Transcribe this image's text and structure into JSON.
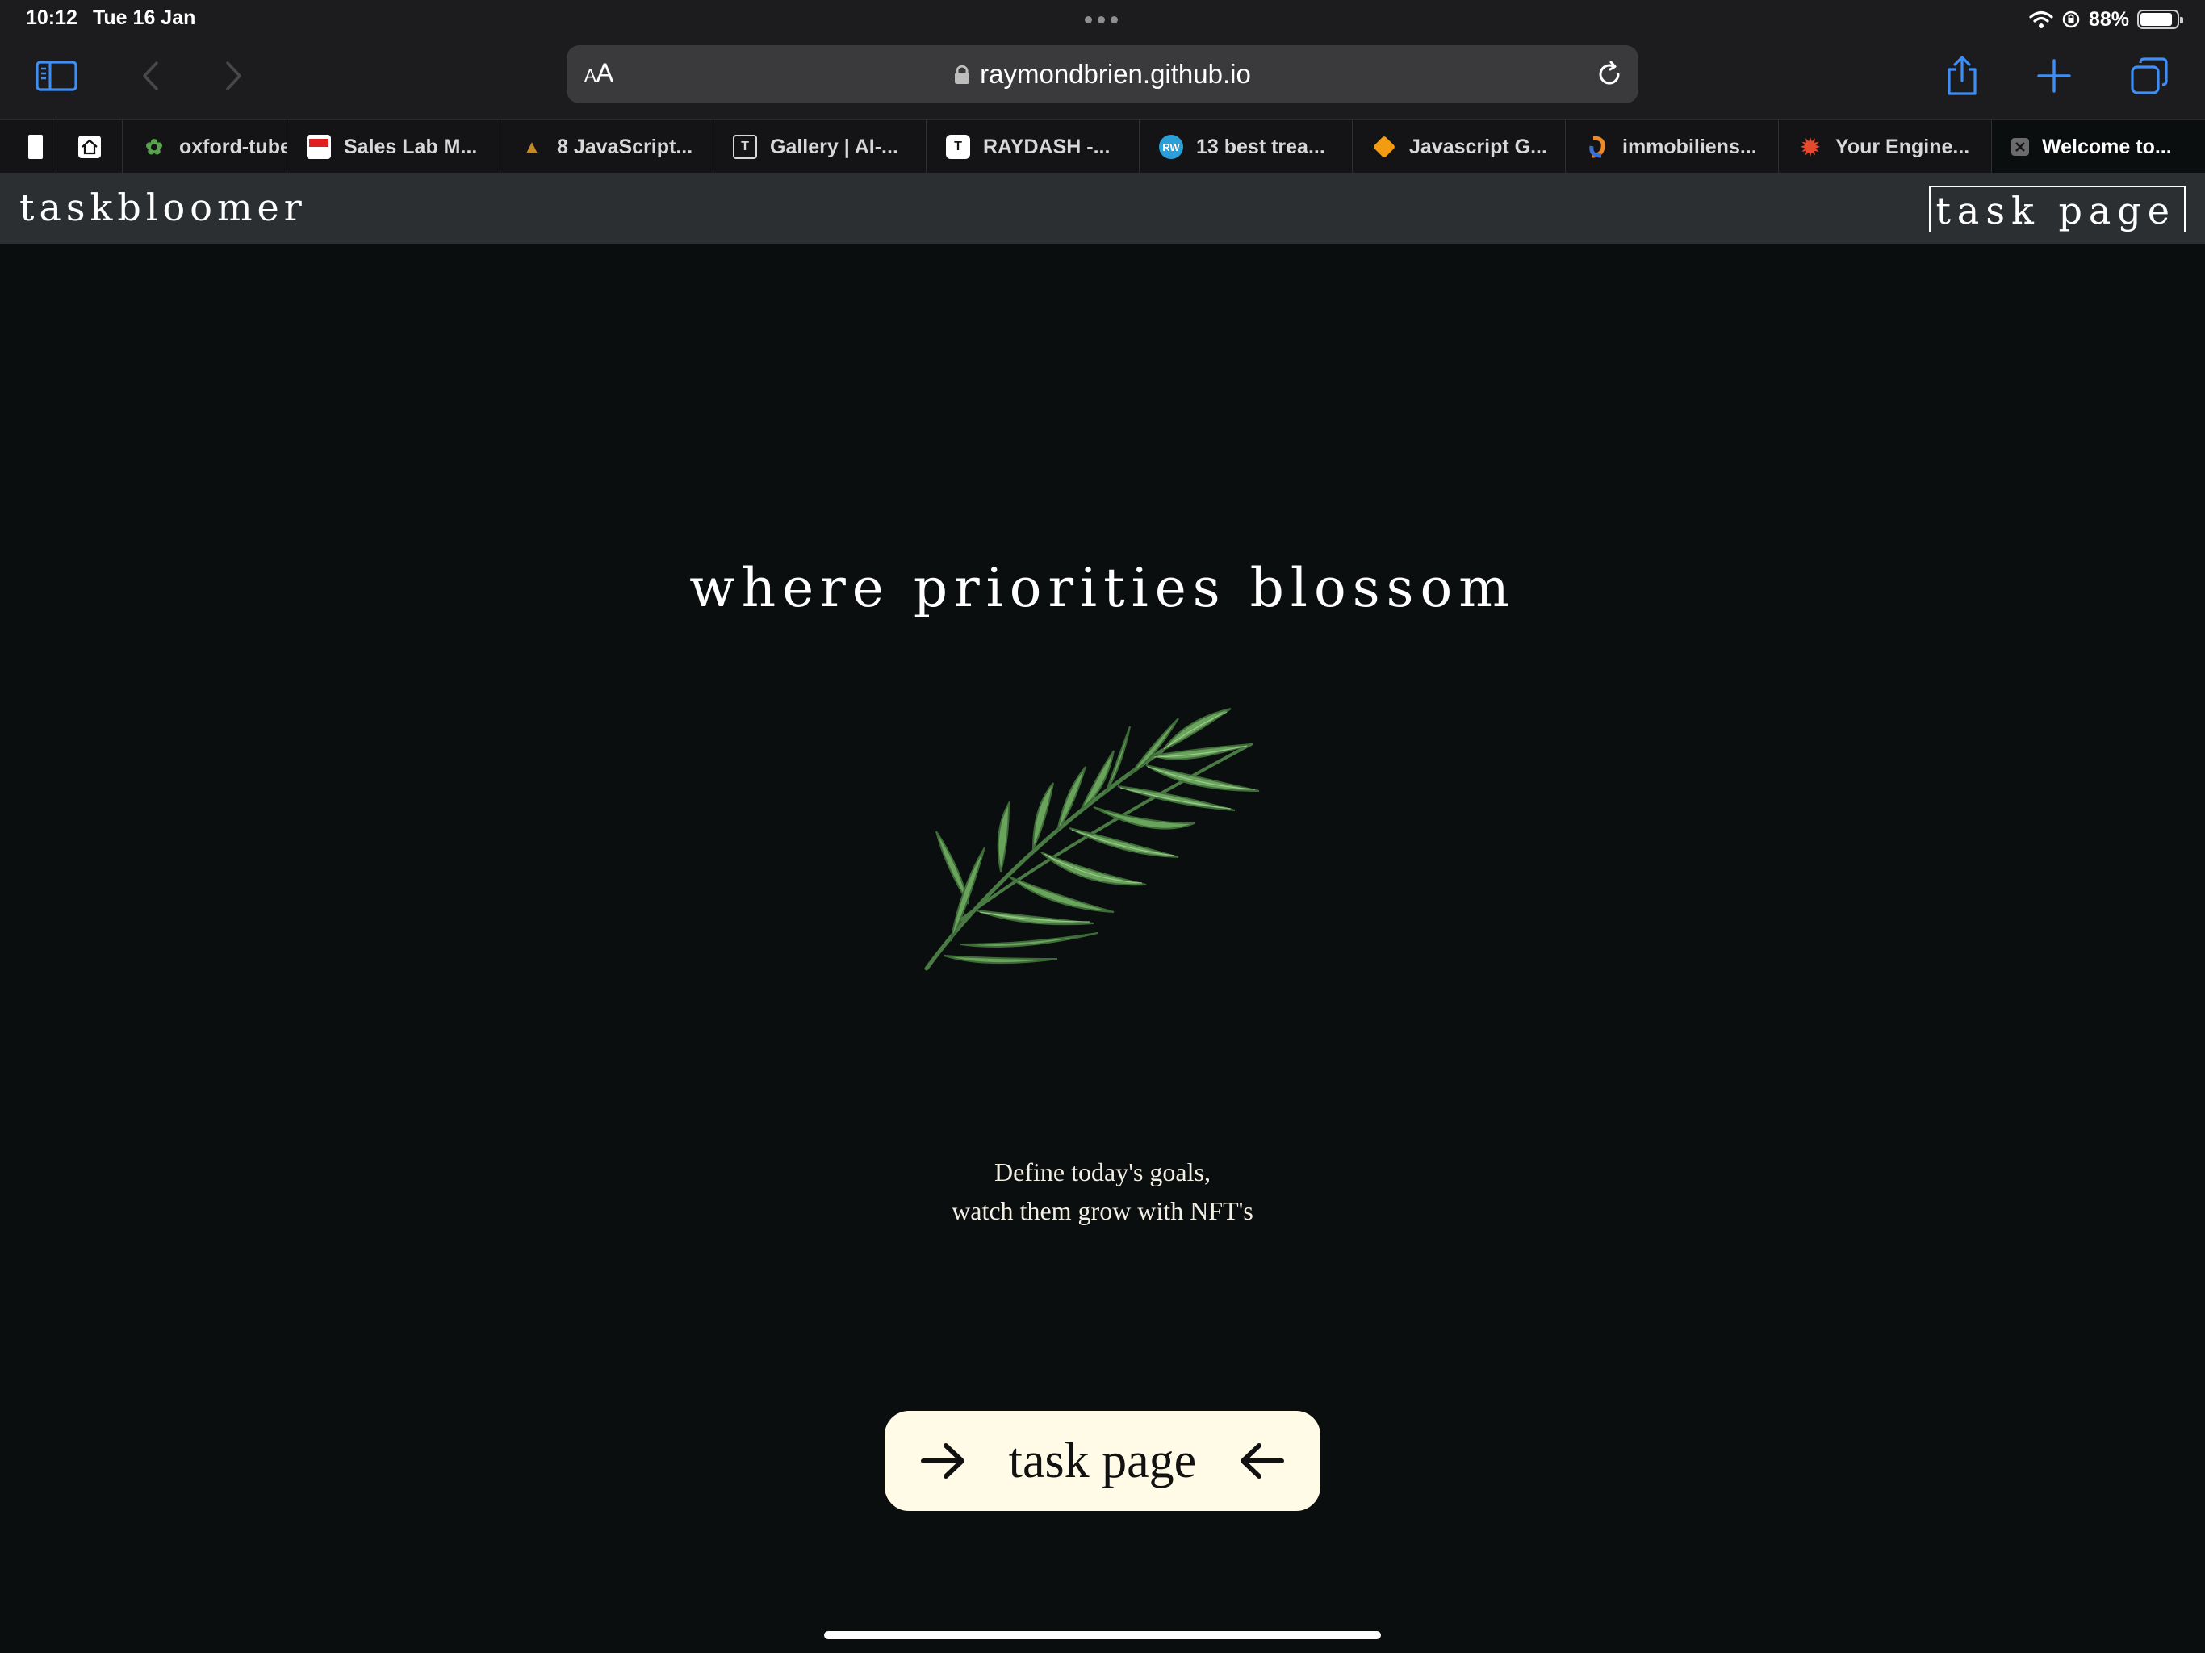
{
  "status_bar": {
    "time": "10:12",
    "date": "Tue 16 Jan",
    "battery": "88%",
    "battery_level": 0.88
  },
  "browser": {
    "url": "raymondbrien.github.io",
    "reader_label_small": "A",
    "reader_label_large": "A",
    "tabs": [
      {
        "title": "oxford-tube",
        "icon": "leaf-favicon"
      },
      {
        "title": "Sales Lab M...",
        "icon": "red-box-favicon"
      },
      {
        "title": "8 JavaScript...",
        "icon": "hat-favicon"
      },
      {
        "title": "Gallery | AI-...",
        "icon": "t-favicon",
        "icon_text": "T"
      },
      {
        "title": "RAYDASH -...",
        "icon": "t-circle-favicon",
        "icon_text": "T"
      },
      {
        "title": "13 best trea...",
        "icon": "rw-favicon",
        "icon_text": "RW"
      },
      {
        "title": "Javascript G...",
        "icon": "orange-diamond-favicon"
      },
      {
        "title": "immobiliens...",
        "icon": "swirl-favicon"
      },
      {
        "title": "Your Engine...",
        "icon": "gear-favicon"
      },
      {
        "title": "Welcome to...",
        "icon": "close-icon"
      }
    ]
  },
  "site": {
    "brand": "taskbloomer",
    "nav_link": "task page",
    "hero_title": "where priorities blossom",
    "tagline_line1": "Define today's goals,",
    "tagline_line2": "watch them grow with NFT's",
    "cta_label": "task page"
  },
  "colors": {
    "page_bg": "#0b0e0e",
    "header_bg": "#2b2f32",
    "cta_bg": "#fffbe6",
    "browser_accent": "#3d8ef7",
    "sprig_green": "#5f9a55"
  }
}
